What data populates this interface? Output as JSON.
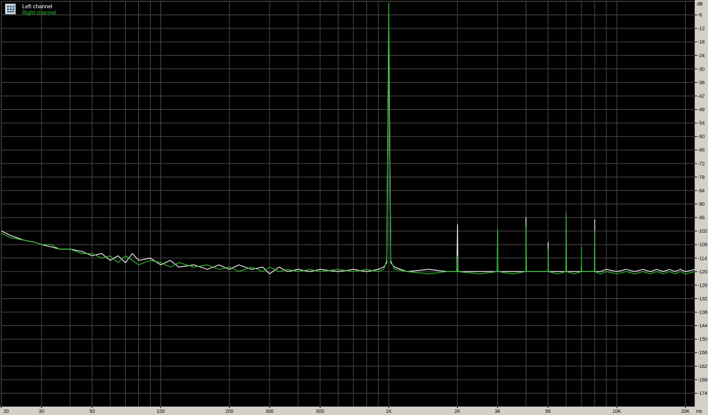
{
  "colors": {
    "background": "#000000",
    "plot_area": "#000000",
    "grid": "#4a4a4a",
    "axis_panel": "#d4d0c8",
    "axis_text": "#000000",
    "left_channel": "#ffffff",
    "right_channel": "#2fc02f"
  },
  "legend": {
    "icon": "spectrum-analyzer-icon",
    "left_channel": "Left channel",
    "right_channel": "Right channel"
  },
  "chart_data": {
    "type": "line",
    "title": "",
    "xlabel": "",
    "ylabel": "",
    "x_unit": "Hz",
    "y_unit": "dB",
    "x_scale": "log",
    "xlim": [
      20,
      22000
    ],
    "ylim": [
      -180,
      0
    ],
    "grid": true,
    "legend_position": "top-left",
    "x_ticks": [
      {
        "value": 20,
        "label": "20"
      },
      {
        "value": 30,
        "label": "30"
      },
      {
        "value": 50,
        "label": "50"
      },
      {
        "value": 100,
        "label": "100"
      },
      {
        "value": 200,
        "label": "200"
      },
      {
        "value": 300,
        "label": "300"
      },
      {
        "value": 500,
        "label": "500"
      },
      {
        "value": 1000,
        "label": "1K"
      },
      {
        "value": 2000,
        "label": "2K"
      },
      {
        "value": 3000,
        "label": "3K"
      },
      {
        "value": 5000,
        "label": "5K"
      },
      {
        "value": 10000,
        "label": "10K"
      },
      {
        "value": 20000,
        "label": "20K"
      }
    ],
    "x_minor_grid": [
      40,
      60,
      70,
      80,
      90,
      400,
      600,
      700,
      800,
      900,
      4000,
      6000,
      7000,
      8000,
      9000
    ],
    "y_ticks": [
      {
        "value": -6,
        "label": "-6"
      },
      {
        "value": -12,
        "label": "-12"
      },
      {
        "value": -18,
        "label": "-18"
      },
      {
        "value": -24,
        "label": "-24"
      },
      {
        "value": -30,
        "label": "-30"
      },
      {
        "value": -36,
        "label": "-36"
      },
      {
        "value": -42,
        "label": "-42"
      },
      {
        "value": -48,
        "label": "-48"
      },
      {
        "value": -54,
        "label": "-54"
      },
      {
        "value": -60,
        "label": "-60"
      },
      {
        "value": -66,
        "label": "-66"
      },
      {
        "value": -72,
        "label": "-72"
      },
      {
        "value": -78,
        "label": "-78"
      },
      {
        "value": -84,
        "label": "-84"
      },
      {
        "value": -90,
        "label": "-90"
      },
      {
        "value": -96,
        "label": "-96"
      },
      {
        "value": -102,
        "label": "-102"
      },
      {
        "value": -108,
        "label": "-108"
      },
      {
        "value": -114,
        "label": "-114"
      },
      {
        "value": -120,
        "label": "-120"
      },
      {
        "value": -126,
        "label": "-126"
      },
      {
        "value": -132,
        "label": "-132"
      },
      {
        "value": -138,
        "label": "-138"
      },
      {
        "value": -144,
        "label": "-144"
      },
      {
        "value": -150,
        "label": "-150"
      },
      {
        "value": -156,
        "label": "-156"
      },
      {
        "value": -162,
        "label": "-162"
      },
      {
        "value": -168,
        "label": "-168"
      },
      {
        "value": -174,
        "label": "-174"
      }
    ],
    "series": [
      {
        "name": "Left channel",
        "color": "#ffffff",
        "points": [
          [
            20,
            -102
          ],
          [
            22,
            -104
          ],
          [
            25,
            -106
          ],
          [
            28,
            -107
          ],
          [
            30,
            -108
          ],
          [
            33,
            -109
          ],
          [
            36,
            -110
          ],
          [
            40,
            -110
          ],
          [
            45,
            -111
          ],
          [
            50,
            -113
          ],
          [
            55,
            -112
          ],
          [
            60,
            -115
          ],
          [
            65,
            -113
          ],
          [
            70,
            -116
          ],
          [
            75,
            -112
          ],
          [
            80,
            -115
          ],
          [
            90,
            -114
          ],
          [
            100,
            -117
          ],
          [
            110,
            -115
          ],
          [
            120,
            -118
          ],
          [
            140,
            -117
          ],
          [
            160,
            -119
          ],
          [
            180,
            -117
          ],
          [
            200,
            -119
          ],
          [
            220,
            -117
          ],
          [
            250,
            -119
          ],
          [
            280,
            -118
          ],
          [
            300,
            -121
          ],
          [
            330,
            -118
          ],
          [
            360,
            -120
          ],
          [
            400,
            -119
          ],
          [
            450,
            -120
          ],
          [
            500,
            -119
          ],
          [
            600,
            -120
          ],
          [
            700,
            -119
          ],
          [
            800,
            -120
          ],
          [
            900,
            -119
          ],
          [
            950,
            -118
          ],
          [
            980,
            -116
          ],
          [
            1000,
            -6
          ],
          [
            1020,
            -116
          ],
          [
            1060,
            -118
          ],
          [
            1200,
            -120
          ],
          [
            1500,
            -119
          ],
          [
            1800,
            -120
          ],
          [
            1990,
            -120
          ],
          [
            2000,
            -99
          ],
          [
            2010,
            -120
          ],
          [
            2500,
            -120
          ],
          [
            2990,
            -120
          ],
          [
            3000,
            -102
          ],
          [
            3010,
            -120
          ],
          [
            3500,
            -120
          ],
          [
            3990,
            -120
          ],
          [
            4000,
            -96
          ],
          [
            4010,
            -120
          ],
          [
            4500,
            -120
          ],
          [
            4990,
            -120
          ],
          [
            5000,
            -107
          ],
          [
            5010,
            -120
          ],
          [
            5500,
            -120
          ],
          [
            5990,
            -120
          ],
          [
            6000,
            -96
          ],
          [
            6010,
            -120
          ],
          [
            6500,
            -120
          ],
          [
            6990,
            -120
          ],
          [
            7000,
            -117
          ],
          [
            7010,
            -120
          ],
          [
            7500,
            -120
          ],
          [
            7990,
            -120
          ],
          [
            8000,
            -97
          ],
          [
            8010,
            -120
          ],
          [
            8500,
            -120
          ],
          [
            9000,
            -119
          ],
          [
            10000,
            -120
          ],
          [
            11000,
            -119
          ],
          [
            12000,
            -120
          ],
          [
            13000,
            -119
          ],
          [
            14000,
            -120
          ],
          [
            15000,
            -119
          ],
          [
            16000,
            -120
          ],
          [
            17000,
            -119
          ],
          [
            18000,
            -120
          ],
          [
            19000,
            -119
          ],
          [
            20000,
            -120
          ],
          [
            22000,
            -119
          ]
        ]
      },
      {
        "name": "Right channel",
        "color": "#2fc02f",
        "points": [
          [
            20,
            -103
          ],
          [
            22,
            -105
          ],
          [
            25,
            -106
          ],
          [
            28,
            -107
          ],
          [
            30,
            -108
          ],
          [
            33,
            -108
          ],
          [
            36,
            -110
          ],
          [
            40,
            -110
          ],
          [
            45,
            -112
          ],
          [
            50,
            -112
          ],
          [
            55,
            -114
          ],
          [
            60,
            -113
          ],
          [
            65,
            -116
          ],
          [
            70,
            -113
          ],
          [
            75,
            -115
          ],
          [
            80,
            -117
          ],
          [
            90,
            -115
          ],
          [
            100,
            -116
          ],
          [
            110,
            -118
          ],
          [
            120,
            -116
          ],
          [
            140,
            -118
          ],
          [
            160,
            -117
          ],
          [
            180,
            -119
          ],
          [
            200,
            -118
          ],
          [
            220,
            -120
          ],
          [
            250,
            -118
          ],
          [
            280,
            -120
          ],
          [
            300,
            -118
          ],
          [
            330,
            -120
          ],
          [
            360,
            -119
          ],
          [
            400,
            -120
          ],
          [
            450,
            -119
          ],
          [
            500,
            -120
          ],
          [
            600,
            -119
          ],
          [
            700,
            -120
          ],
          [
            800,
            -119
          ],
          [
            900,
            -120
          ],
          [
            950,
            -119
          ],
          [
            980,
            -115
          ],
          [
            1000,
            -1
          ],
          [
            1020,
            -115
          ],
          [
            1060,
            -119
          ],
          [
            1200,
            -120
          ],
          [
            1500,
            -121
          ],
          [
            1800,
            -120
          ],
          [
            1990,
            -120
          ],
          [
            2000,
            -113
          ],
          [
            2010,
            -120
          ],
          [
            2500,
            -121
          ],
          [
            2990,
            -120
          ],
          [
            3000,
            -101
          ],
          [
            3010,
            -120
          ],
          [
            3500,
            -121
          ],
          [
            3990,
            -120
          ],
          [
            4000,
            -100
          ],
          [
            4010,
            -120
          ],
          [
            4500,
            -120
          ],
          [
            4990,
            -120
          ],
          [
            5000,
            -110
          ],
          [
            5010,
            -120
          ],
          [
            5500,
            -121
          ],
          [
            5990,
            -120
          ],
          [
            6000,
            -94
          ],
          [
            6010,
            -120
          ],
          [
            6500,
            -121
          ],
          [
            6990,
            -120
          ],
          [
            7000,
            -109
          ],
          [
            7010,
            -120
          ],
          [
            7500,
            -120
          ],
          [
            7990,
            -120
          ],
          [
            8000,
            -102
          ],
          [
            8010,
            -120
          ],
          [
            8500,
            -121
          ],
          [
            9000,
            -120
          ],
          [
            10000,
            -121
          ],
          [
            11000,
            -120
          ],
          [
            12000,
            -121
          ],
          [
            13000,
            -120
          ],
          [
            14000,
            -121
          ],
          [
            15000,
            -120
          ],
          [
            16000,
            -121
          ],
          [
            17000,
            -120
          ],
          [
            18000,
            -121
          ],
          [
            19000,
            -120
          ],
          [
            20000,
            -121
          ],
          [
            22000,
            -120
          ]
        ]
      }
    ]
  }
}
